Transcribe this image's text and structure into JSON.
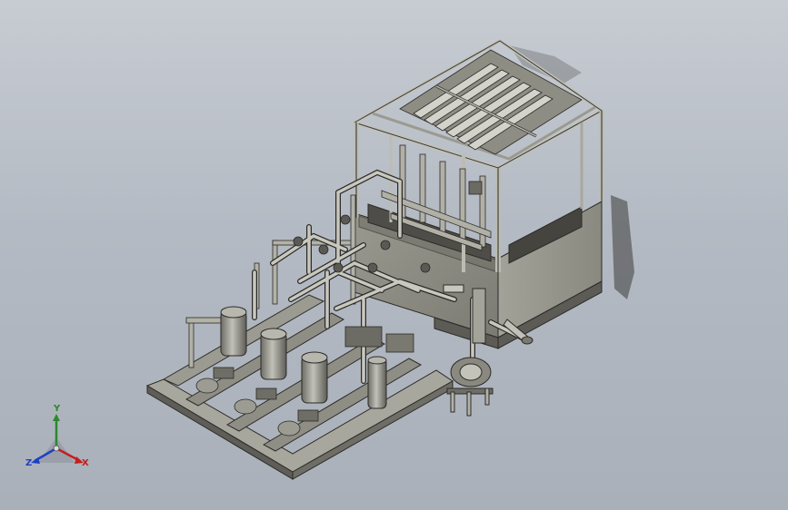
{
  "viewport": {
    "model": "cad-assembly-skid",
    "background_top": "#c7ccd3",
    "background_bottom": "#aab0ba",
    "part_fill": "#8e8d84",
    "part_dark": "#55544e",
    "part_light": "#b7b6ad",
    "edge": "#2b2b28"
  },
  "triad": {
    "x_label": "X",
    "y_label": "Y",
    "z_label": "Z",
    "x_color": "#c41e1e",
    "y_color": "#2a8a2a",
    "z_color": "#1e3fc4"
  }
}
